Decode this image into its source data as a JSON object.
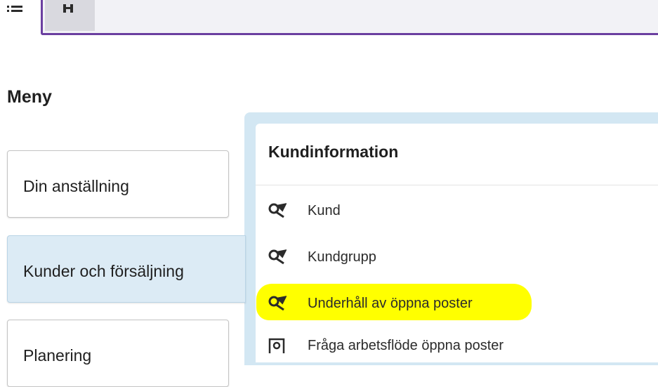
{
  "topbar": {
    "menu_icon": "list-icon",
    "home_icon": "home-icon",
    "accent": "#6b3fa0"
  },
  "page_title": "Meny",
  "menu_cards": [
    {
      "label": "Din anställning"
    },
    {
      "label": "Kunder och försäljning",
      "active": true
    },
    {
      "label": "Planering"
    }
  ],
  "panel": {
    "title": "Kundinformation",
    "links": [
      {
        "label": "Kund",
        "icon": "tools-icon"
      },
      {
        "label": "Kundgrupp",
        "icon": "tools-icon"
      },
      {
        "label": "Underhåll av öppna poster",
        "icon": "tools-icon",
        "highlighted": true
      },
      {
        "label": "Fråga arbetsflöde öppna poster",
        "icon": "inquiry-icon"
      }
    ]
  },
  "colors": {
    "highlight": "#ffff00",
    "active_card": "#dcebf5",
    "panel_border": "#d3e7f3"
  }
}
